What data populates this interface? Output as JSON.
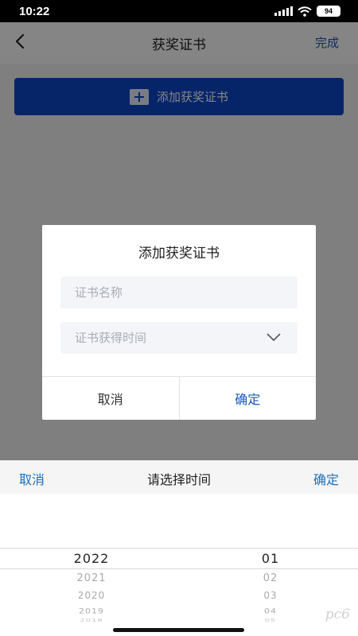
{
  "status_bar": {
    "time": "10:22",
    "battery": "94"
  },
  "navbar": {
    "title": "获奖证书",
    "done_label": "完成"
  },
  "add_button": {
    "label": "添加获奖证书"
  },
  "dialog": {
    "title": "添加获奖证书",
    "name_field": {
      "placeholder": "证书名称",
      "value": ""
    },
    "time_field": {
      "placeholder": "证书获得时间",
      "value": ""
    },
    "cancel_label": "取消",
    "ok_label": "确定"
  },
  "picker": {
    "cancel_label": "取消",
    "title": "请选择时间",
    "ok_label": "确定",
    "years": [
      "2022",
      "2021",
      "2020",
      "2019",
      "2018"
    ],
    "months": [
      "01",
      "02",
      "03",
      "04",
      "05"
    ],
    "selected_year": "2022",
    "selected_month": "01"
  },
  "watermark": "pc6"
}
